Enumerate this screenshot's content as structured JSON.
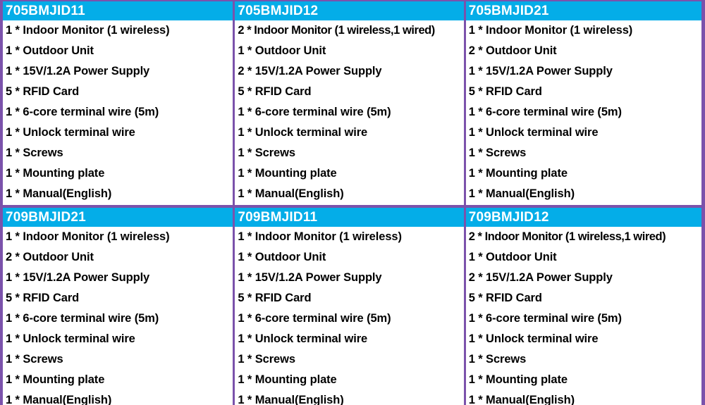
{
  "table": {
    "colors": {
      "header_bg": "#04ade8",
      "header_text": "#ffffff",
      "border": "#7b52ab",
      "cell_bg": "#ffffff",
      "item_text": "#000000"
    },
    "rows": [
      {
        "cells": [
          {
            "model": "705BMJID11",
            "items": [
              "1 * Indoor Monitor (1 wireless)",
              "1 * Outdoor Unit",
              "1 * 15V/1.2A Power Supply",
              "5 * RFID Card",
              "1 * 6-core terminal wire (5m)",
              "1 * Unlock terminal wire",
              "1 * Screws",
              "1 * Mounting plate",
              "1 * Manual(English)"
            ]
          },
          {
            "model": "705BMJID12",
            "items": [
              "2 * Indoor Monitor (1 wireless,1 wired)",
              "1 * Outdoor Unit",
              "2 * 15V/1.2A Power Supply",
              "5 * RFID Card",
              "1 * 6-core terminal wire (5m)",
              "1 * Unlock terminal wire",
              "1 * Screws",
              "1 * Mounting plate",
              "1 * Manual(English)"
            ]
          },
          {
            "model": "705BMJID21",
            "items": [
              "1 * Indoor Monitor (1 wireless)",
              "2 * Outdoor Unit",
              "1 * 15V/1.2A Power Supply",
              "5 * RFID Card",
              "1 * 6-core terminal wire (5m)",
              "1 * Unlock terminal wire",
              "1 * Screws",
              "1 * Mounting plate",
              "1 * Manual(English)"
            ]
          }
        ]
      },
      {
        "cells": [
          {
            "model": "709BMJID21",
            "items": [
              "1 * Indoor Monitor (1 wireless)",
              "2 * Outdoor Unit",
              "1 * 15V/1.2A Power Supply",
              "5 * RFID Card",
              "1 * 6-core terminal wire (5m)",
              "1 * Unlock terminal wire",
              "1 * Screws",
              "1 * Mounting plate",
              "1 * Manual(English)"
            ]
          },
          {
            "model": "709BMJID11",
            "items": [
              "1 * Indoor Monitor (1 wireless)",
              "1 * Outdoor Unit",
              "1 * 15V/1.2A Power Supply",
              "5 * RFID Card",
              "1 * 6-core terminal wire (5m)",
              "1 * Unlock terminal wire",
              "1 * Screws",
              "1 * Mounting plate",
              "1 * Manual(English)"
            ]
          },
          {
            "model": "709BMJID12",
            "items": [
              "2 * Indoor Monitor (1 wireless,1 wired)",
              "1 * Outdoor Unit",
              "2 * 15V/1.2A Power Supply",
              "5 * RFID Card",
              "1 * 6-core terminal wire (5m)",
              "1 * Unlock terminal wire",
              "1 * Screws",
              "1 * Mounting plate",
              "1 * Manual(English)"
            ]
          }
        ]
      }
    ]
  }
}
